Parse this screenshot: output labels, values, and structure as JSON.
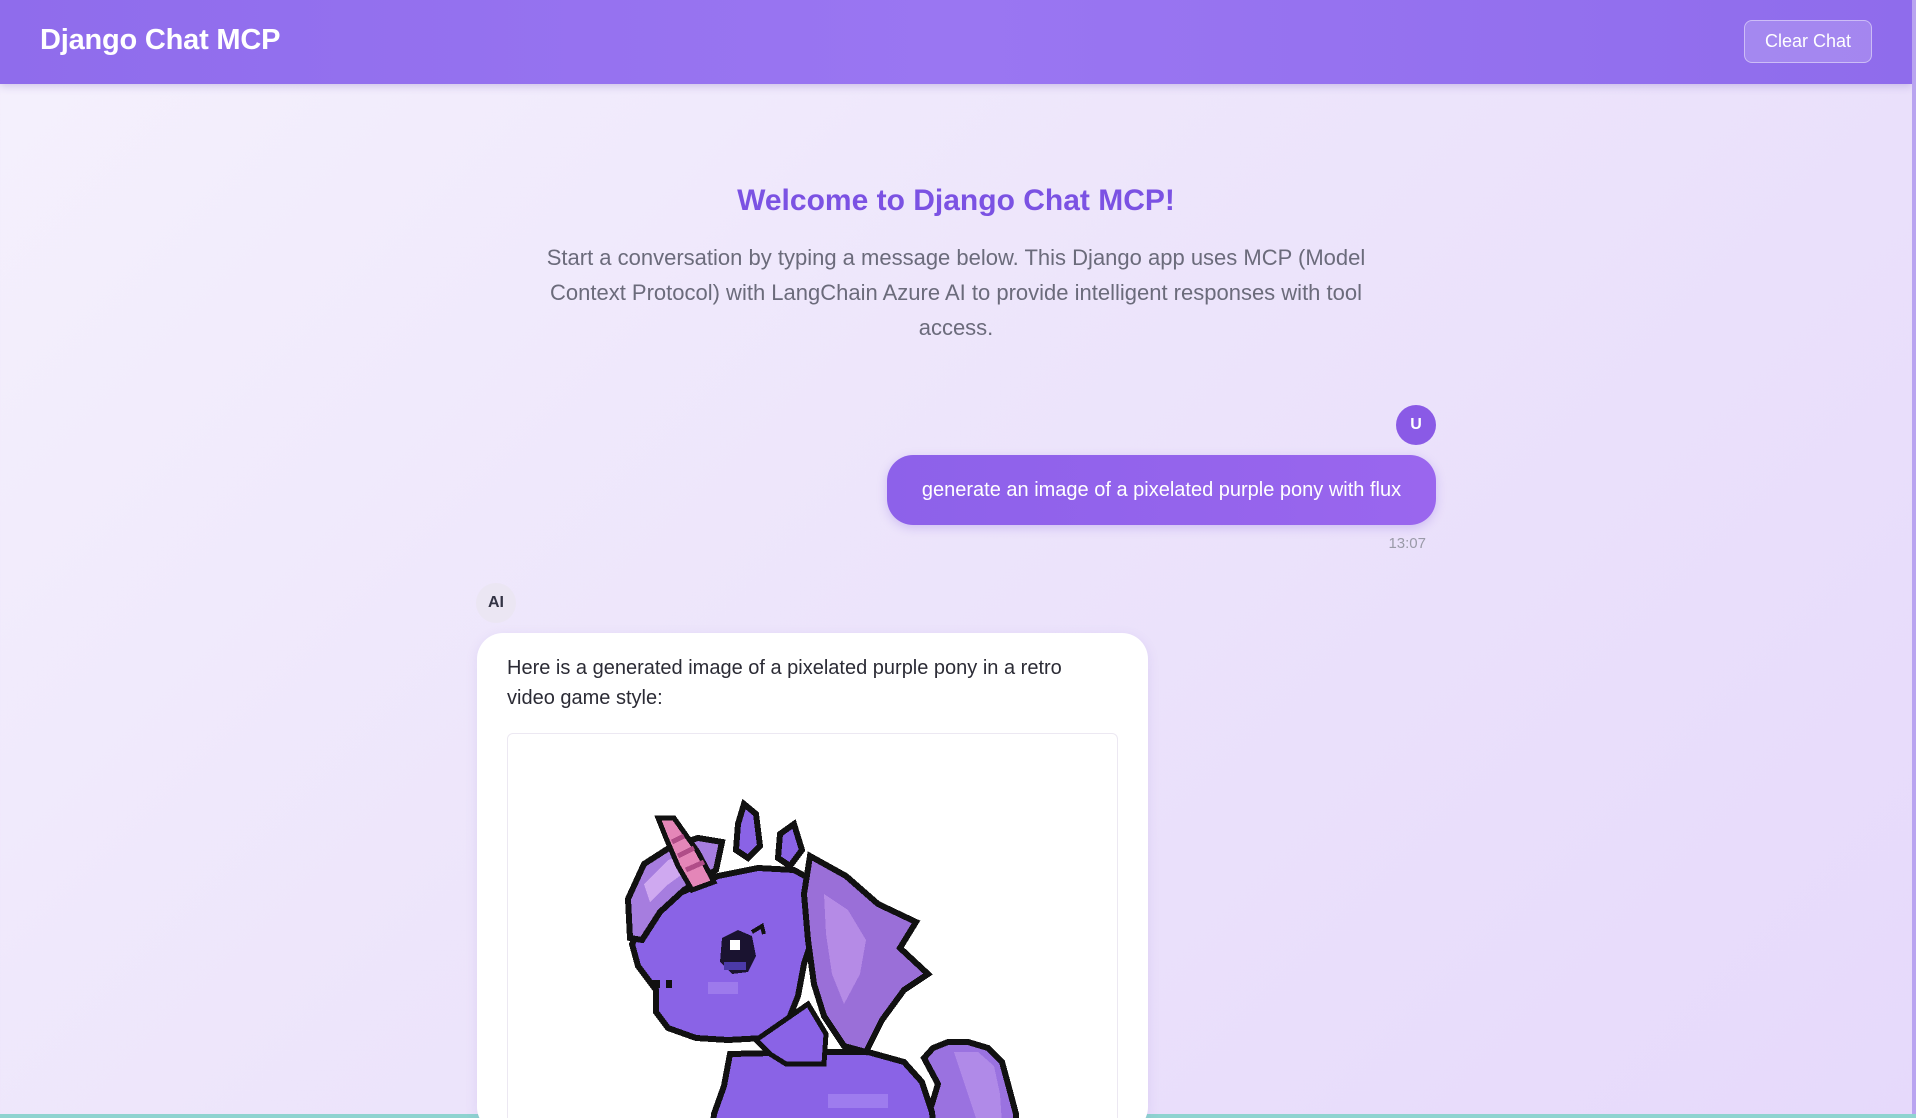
{
  "header": {
    "title": "Django Chat MCP",
    "clear_label": "Clear Chat"
  },
  "welcome": {
    "title": "Welcome to Django Chat MCP!",
    "text": "Start a conversation by typing a message below. This Django app uses MCP (Model Context Protocol) with LangChain Azure AI to provide intelligent responses with tool access."
  },
  "messages": [
    {
      "role": "user",
      "avatar": "U",
      "text": "generate an image of a pixelated purple pony with flux",
      "time": "13:07"
    },
    {
      "role": "ai",
      "avatar": "AI",
      "text": "Here is a generated image of a pixelated purple pony in a retro video game style:",
      "image_icon": "pixel-purple-pony-image"
    }
  ],
  "colors": {
    "header": "#9070ee",
    "accent": "#7b52e3",
    "user_bubble": "#9264eb",
    "pony_body": "#8a63e6"
  }
}
